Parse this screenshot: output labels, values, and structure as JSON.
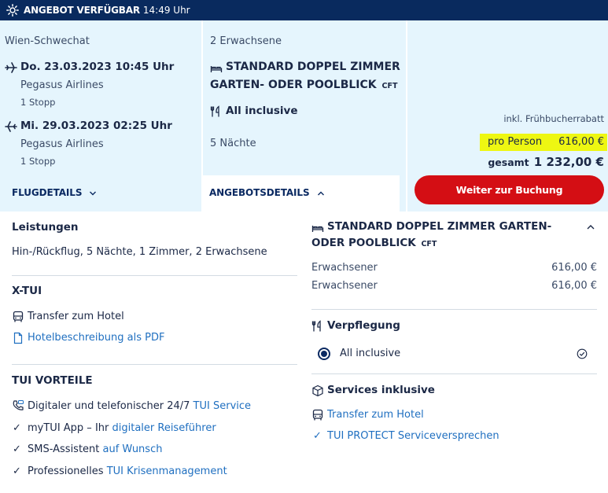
{
  "topbar": {
    "title": "ANGEBOT VERFÜGBAR",
    "time": "14:49 Uhr"
  },
  "flight": {
    "origin": "Wien-Schwechat",
    "outbound": {
      "date": "Do. 23.03.2023 10:45 Uhr",
      "airline": "Pegasus Airlines",
      "stops": "1 Stopp"
    },
    "inbound": {
      "date": "Mi. 29.03.2023 02:25 Uhr",
      "airline": "Pegasus Airlines",
      "stops": "1 Stopp"
    },
    "details_link": "FLUGDETAILS"
  },
  "hotel": {
    "travellers": "2 Erwachsene",
    "room_line1": "STANDARD DOPPEL ZIMMER",
    "room_line2": "GARTEN- ODER POOLBLICK",
    "room_code": "CFT",
    "board": "All inclusive",
    "nights": "5 Nächte",
    "details_link": "ANGEBOTSDETAILS"
  },
  "price": {
    "discount_note": "inkl. Frühbucherrabatt",
    "per_person_label": "pro Person",
    "per_person_value": "616,00 €",
    "total_label": "gesamt",
    "total_value": "1 232,00 €",
    "cta": "Weiter zur Buchung",
    "highlight_color": "#eef712",
    "cta_color": "#d40e14"
  },
  "leistungen": {
    "title": "Leistungen",
    "text": "Hin-/Rückflug, 5 Nächte, 1 Zimmer, 2 Erwachsene"
  },
  "xtui": {
    "title": "X-TUI",
    "transfer": "Transfer zum Hotel",
    "pdf_link": "Hotelbeschreibung als PDF"
  },
  "vorteile": {
    "title": "TUI VORTEILE",
    "items": [
      {
        "pre": "Digitaler und telefonischer 24/7 ",
        "link": "TUI Service"
      },
      {
        "pre": "myTUI App – Ihr ",
        "link": "digitaler Reiseführer"
      },
      {
        "pre": "SMS-Assistent ",
        "link": "auf Wunsch"
      },
      {
        "pre": "Professionelles ",
        "link": "TUI Krisenmanagement"
      }
    ]
  },
  "room_detail": {
    "line1": "STANDARD DOPPEL ZIMMER GARTEN-",
    "line2": "ODER POOLBLICK",
    "code": "CFT",
    "rows": [
      {
        "label": "Erwachsener",
        "value": "616,00 €"
      },
      {
        "label": "Erwachsener",
        "value": "616,00 €"
      }
    ]
  },
  "verpflegung": {
    "title": "Verpflegung",
    "option": "All inclusive"
  },
  "services": {
    "title": "Services inklusive",
    "transfer": "Transfer zum Hotel",
    "protect_link": "TUI PROTECT",
    "protect_rest": "Serviceversprechen"
  }
}
